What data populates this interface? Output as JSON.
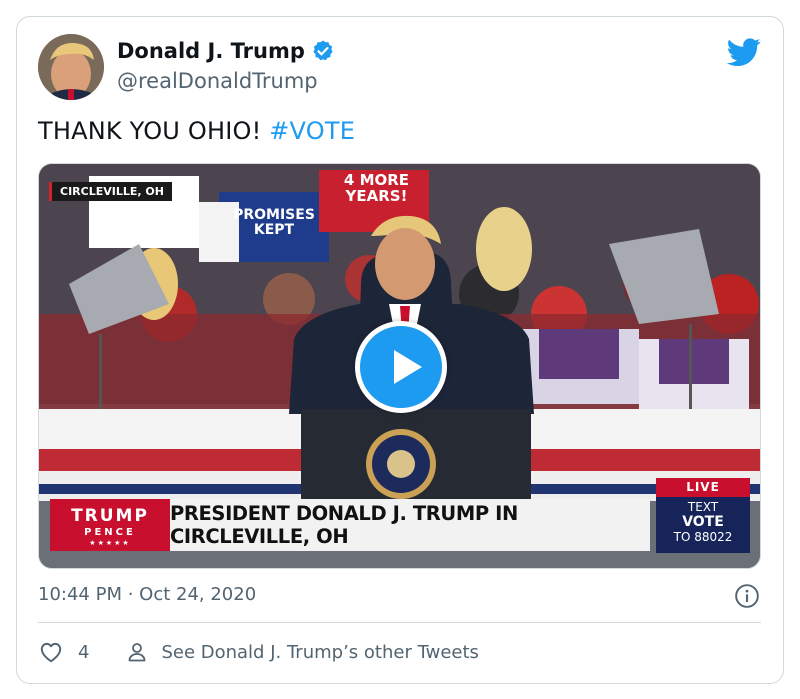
{
  "author": {
    "display_name": "Donald J. Trump",
    "handle": "@realDonaldTrump",
    "verified": true
  },
  "tweet": {
    "text": "THANK YOU OHIO! ",
    "hashtag": "#VOTE"
  },
  "media": {
    "location_tag": "CIRCLEVILLE, OH",
    "signs": {
      "four_more_years": "4 MORE YEARS!",
      "promises_kept": "PROMISES KEPT"
    },
    "lower_third": {
      "logo_line1": "TRUMP",
      "logo_line2": "PENCE",
      "logo_line3": "★★★★★",
      "headline": "PRESIDENT DONALD J. TRUMP IN CIRCLEVILLE, OH",
      "live_label": "LIVE",
      "text_line1": "TEXT",
      "text_line2": "VOTE",
      "text_line3": "TO 88022"
    }
  },
  "timestamp": "10:44 PM · Oct 24, 2020",
  "actions": {
    "like_count": "4",
    "other_tweets_label": "See Donald J. Trump’s other Tweets"
  },
  "colors": {
    "accent": "#1d9bf0",
    "text_primary": "#0f1419",
    "text_secondary": "#536471",
    "border": "#cfd9de"
  },
  "icons": [
    "verified-badge-icon",
    "twitter-bird-icon",
    "play-icon",
    "info-icon",
    "heart-icon",
    "person-icon"
  ]
}
